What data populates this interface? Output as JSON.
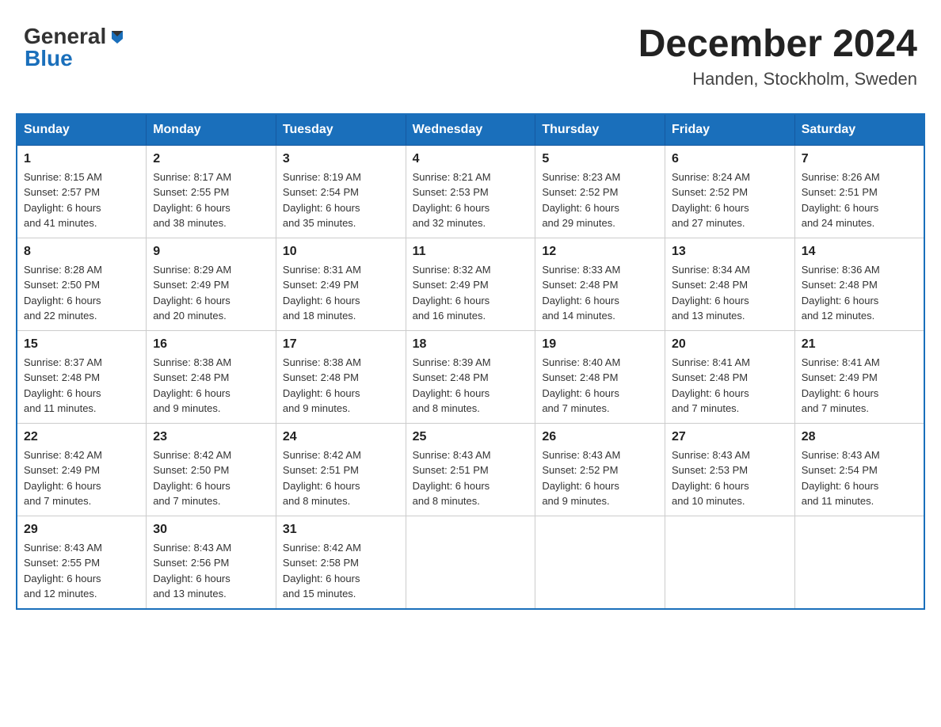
{
  "header": {
    "logo_general": "General",
    "logo_blue": "Blue",
    "month_title": "December 2024",
    "location": "Handen, Stockholm, Sweden"
  },
  "weekdays": [
    "Sunday",
    "Monday",
    "Tuesday",
    "Wednesday",
    "Thursday",
    "Friday",
    "Saturday"
  ],
  "weeks": [
    [
      {
        "day": "1",
        "sunrise": "8:15 AM",
        "sunset": "2:57 PM",
        "daylight": "6 hours and 41 minutes."
      },
      {
        "day": "2",
        "sunrise": "8:17 AM",
        "sunset": "2:55 PM",
        "daylight": "6 hours and 38 minutes."
      },
      {
        "day": "3",
        "sunrise": "8:19 AM",
        "sunset": "2:54 PM",
        "daylight": "6 hours and 35 minutes."
      },
      {
        "day": "4",
        "sunrise": "8:21 AM",
        "sunset": "2:53 PM",
        "daylight": "6 hours and 32 minutes."
      },
      {
        "day": "5",
        "sunrise": "8:23 AM",
        "sunset": "2:52 PM",
        "daylight": "6 hours and 29 minutes."
      },
      {
        "day": "6",
        "sunrise": "8:24 AM",
        "sunset": "2:52 PM",
        "daylight": "6 hours and 27 minutes."
      },
      {
        "day": "7",
        "sunrise": "8:26 AM",
        "sunset": "2:51 PM",
        "daylight": "6 hours and 24 minutes."
      }
    ],
    [
      {
        "day": "8",
        "sunrise": "8:28 AM",
        "sunset": "2:50 PM",
        "daylight": "6 hours and 22 minutes."
      },
      {
        "day": "9",
        "sunrise": "8:29 AM",
        "sunset": "2:49 PM",
        "daylight": "6 hours and 20 minutes."
      },
      {
        "day": "10",
        "sunrise": "8:31 AM",
        "sunset": "2:49 PM",
        "daylight": "6 hours and 18 minutes."
      },
      {
        "day": "11",
        "sunrise": "8:32 AM",
        "sunset": "2:49 PM",
        "daylight": "6 hours and 16 minutes."
      },
      {
        "day": "12",
        "sunrise": "8:33 AM",
        "sunset": "2:48 PM",
        "daylight": "6 hours and 14 minutes."
      },
      {
        "day": "13",
        "sunrise": "8:34 AM",
        "sunset": "2:48 PM",
        "daylight": "6 hours and 13 minutes."
      },
      {
        "day": "14",
        "sunrise": "8:36 AM",
        "sunset": "2:48 PM",
        "daylight": "6 hours and 12 minutes."
      }
    ],
    [
      {
        "day": "15",
        "sunrise": "8:37 AM",
        "sunset": "2:48 PM",
        "daylight": "6 hours and 11 minutes."
      },
      {
        "day": "16",
        "sunrise": "8:38 AM",
        "sunset": "2:48 PM",
        "daylight": "6 hours and 9 minutes."
      },
      {
        "day": "17",
        "sunrise": "8:38 AM",
        "sunset": "2:48 PM",
        "daylight": "6 hours and 9 minutes."
      },
      {
        "day": "18",
        "sunrise": "8:39 AM",
        "sunset": "2:48 PM",
        "daylight": "6 hours and 8 minutes."
      },
      {
        "day": "19",
        "sunrise": "8:40 AM",
        "sunset": "2:48 PM",
        "daylight": "6 hours and 7 minutes."
      },
      {
        "day": "20",
        "sunrise": "8:41 AM",
        "sunset": "2:48 PM",
        "daylight": "6 hours and 7 minutes."
      },
      {
        "day": "21",
        "sunrise": "8:41 AM",
        "sunset": "2:49 PM",
        "daylight": "6 hours and 7 minutes."
      }
    ],
    [
      {
        "day": "22",
        "sunrise": "8:42 AM",
        "sunset": "2:49 PM",
        "daylight": "6 hours and 7 minutes."
      },
      {
        "day": "23",
        "sunrise": "8:42 AM",
        "sunset": "2:50 PM",
        "daylight": "6 hours and 7 minutes."
      },
      {
        "day": "24",
        "sunrise": "8:42 AM",
        "sunset": "2:51 PM",
        "daylight": "6 hours and 8 minutes."
      },
      {
        "day": "25",
        "sunrise": "8:43 AM",
        "sunset": "2:51 PM",
        "daylight": "6 hours and 8 minutes."
      },
      {
        "day": "26",
        "sunrise": "8:43 AM",
        "sunset": "2:52 PM",
        "daylight": "6 hours and 9 minutes."
      },
      {
        "day": "27",
        "sunrise": "8:43 AM",
        "sunset": "2:53 PM",
        "daylight": "6 hours and 10 minutes."
      },
      {
        "day": "28",
        "sunrise": "8:43 AM",
        "sunset": "2:54 PM",
        "daylight": "6 hours and 11 minutes."
      }
    ],
    [
      {
        "day": "29",
        "sunrise": "8:43 AM",
        "sunset": "2:55 PM",
        "daylight": "6 hours and 12 minutes."
      },
      {
        "day": "30",
        "sunrise": "8:43 AM",
        "sunset": "2:56 PM",
        "daylight": "6 hours and 13 minutes."
      },
      {
        "day": "31",
        "sunrise": "8:42 AM",
        "sunset": "2:58 PM",
        "daylight": "6 hours and 15 minutes."
      },
      null,
      null,
      null,
      null
    ]
  ],
  "labels": {
    "sunrise_prefix": "Sunrise: ",
    "sunset_prefix": "Sunset: ",
    "daylight_prefix": "Daylight: "
  }
}
